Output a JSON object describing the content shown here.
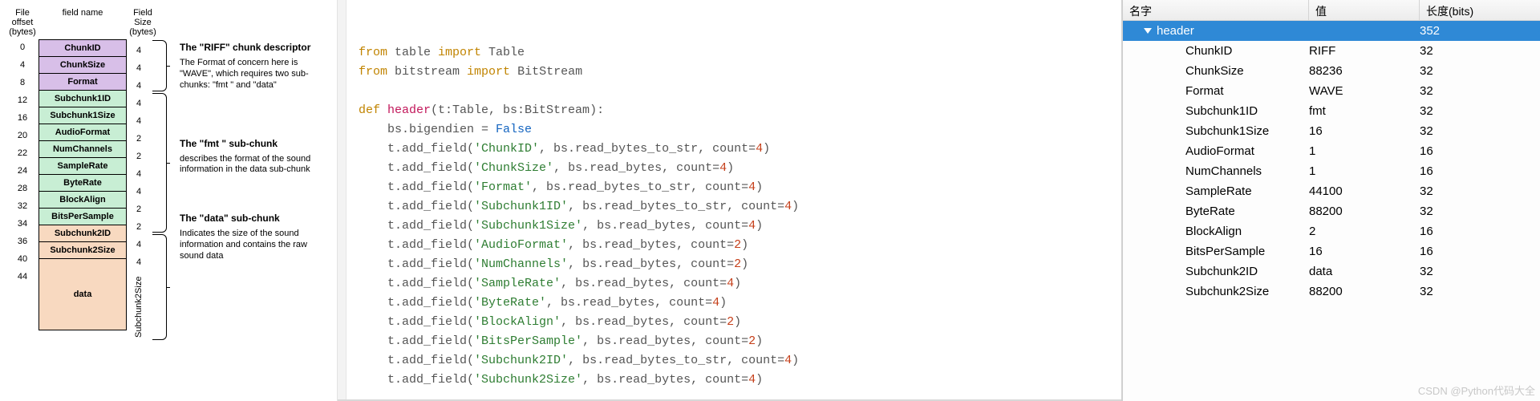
{
  "diagram": {
    "headers": {
      "offset": "File offset\n(bytes)",
      "name": "field name",
      "size": "Field Size\n(bytes)"
    },
    "offsets": [
      "0",
      "4",
      "8",
      "12",
      "16",
      "20",
      "22",
      "24",
      "28",
      "32",
      "34",
      "36",
      "40",
      "44"
    ],
    "fields": [
      {
        "name": "ChunkID",
        "size": "4",
        "cls": "c-purple"
      },
      {
        "name": "ChunkSize",
        "size": "4",
        "cls": "c-purple"
      },
      {
        "name": "Format",
        "size": "4",
        "cls": "c-purple"
      },
      {
        "name": "Subchunk1ID",
        "size": "4",
        "cls": "c-green"
      },
      {
        "name": "Subchunk1Size",
        "size": "4",
        "cls": "c-green"
      },
      {
        "name": "AudioFormat",
        "size": "2",
        "cls": "c-green"
      },
      {
        "name": "NumChannels",
        "size": "2",
        "cls": "c-green"
      },
      {
        "name": "SampleRate",
        "size": "4",
        "cls": "c-green"
      },
      {
        "name": "ByteRate",
        "size": "4",
        "cls": "c-green"
      },
      {
        "name": "BlockAlign",
        "size": "2",
        "cls": "c-green"
      },
      {
        "name": "BitsPerSample",
        "size": "2",
        "cls": "c-green"
      },
      {
        "name": "Subchunk2ID",
        "size": "4",
        "cls": "c-peach"
      },
      {
        "name": "Subchunk2Size",
        "size": "4",
        "cls": "c-peach"
      },
      {
        "name": "data",
        "size": "Subchunk2Size",
        "cls": "c-peach",
        "tall": true
      }
    ],
    "desc": [
      {
        "title": "The \"RIFF\" chunk descriptor",
        "text": "The Format of concern here is \"WAVE\", which requires two sub-chunks: \"fmt \" and \"data\""
      },
      {
        "title": "The \"fmt \" sub-chunk",
        "text": "describes the format of the sound information in the data sub-chunk"
      },
      {
        "title": "The \"data\" sub-chunk",
        "text": "Indicates the size of the sound information and contains the raw sound data"
      }
    ]
  },
  "code": {
    "lines": [
      {
        "t": "import",
        "p": [
          [
            "kw",
            "from"
          ],
          [
            "id",
            " table "
          ],
          [
            "kw",
            "import"
          ],
          [
            "id",
            " Table"
          ]
        ]
      },
      {
        "t": "import",
        "p": [
          [
            "kw",
            "from"
          ],
          [
            "id",
            " bitstream "
          ],
          [
            "kw",
            "import"
          ],
          [
            "id",
            " BitStream"
          ]
        ]
      },
      {
        "t": "blank",
        "p": []
      },
      {
        "t": "def",
        "p": [
          [
            "kw",
            "def "
          ],
          [
            "fn",
            "header"
          ],
          [
            "id",
            "(t:Table, bs:BitStream):"
          ]
        ]
      },
      {
        "t": "body",
        "p": [
          [
            "id",
            "    bs.bigendien = "
          ],
          [
            "const",
            "False"
          ]
        ]
      },
      {
        "t": "body",
        "p": [
          [
            "id",
            "    t.add_field("
          ],
          [
            "str",
            "'ChunkID'"
          ],
          [
            "id",
            ", bs.read_bytes_to_str, count="
          ],
          [
            "num",
            "4"
          ],
          [
            "id",
            ")"
          ]
        ]
      },
      {
        "t": "body",
        "p": [
          [
            "id",
            "    t.add_field("
          ],
          [
            "str",
            "'ChunkSize'"
          ],
          [
            "id",
            ", bs.read_bytes, count="
          ],
          [
            "num",
            "4"
          ],
          [
            "id",
            ")"
          ]
        ]
      },
      {
        "t": "body",
        "p": [
          [
            "id",
            "    t.add_field("
          ],
          [
            "str",
            "'Format'"
          ],
          [
            "id",
            ", bs.read_bytes_to_str, count="
          ],
          [
            "num",
            "4"
          ],
          [
            "id",
            ")"
          ]
        ]
      },
      {
        "t": "body",
        "p": [
          [
            "id",
            "    t.add_field("
          ],
          [
            "str",
            "'Subchunk1ID'"
          ],
          [
            "id",
            ", bs.read_bytes_to_str, count="
          ],
          [
            "num",
            "4"
          ],
          [
            "id",
            ")"
          ]
        ]
      },
      {
        "t": "body",
        "p": [
          [
            "id",
            "    t.add_field("
          ],
          [
            "str",
            "'Subchunk1Size'"
          ],
          [
            "id",
            ", bs.read_bytes, count="
          ],
          [
            "num",
            "4"
          ],
          [
            "id",
            ")"
          ]
        ]
      },
      {
        "t": "body",
        "p": [
          [
            "id",
            "    t.add_field("
          ],
          [
            "str",
            "'AudioFormat'"
          ],
          [
            "id",
            ", bs.read_bytes, count="
          ],
          [
            "num",
            "2"
          ],
          [
            "id",
            ")"
          ]
        ]
      },
      {
        "t": "body",
        "p": [
          [
            "id",
            "    t.add_field("
          ],
          [
            "str",
            "'NumChannels'"
          ],
          [
            "id",
            ", bs.read_bytes, count="
          ],
          [
            "num",
            "2"
          ],
          [
            "id",
            ")"
          ]
        ]
      },
      {
        "t": "body",
        "p": [
          [
            "id",
            "    t.add_field("
          ],
          [
            "str",
            "'SampleRate'"
          ],
          [
            "id",
            ", bs.read_bytes, count="
          ],
          [
            "num",
            "4"
          ],
          [
            "id",
            ")"
          ]
        ]
      },
      {
        "t": "body",
        "p": [
          [
            "id",
            "    t.add_field("
          ],
          [
            "str",
            "'ByteRate'"
          ],
          [
            "id",
            ", bs.read_bytes, count="
          ],
          [
            "num",
            "4"
          ],
          [
            "id",
            ")"
          ]
        ]
      },
      {
        "t": "body",
        "p": [
          [
            "id",
            "    t.add_field("
          ],
          [
            "str",
            "'BlockAlign'"
          ],
          [
            "id",
            ", bs.read_bytes, count="
          ],
          [
            "num",
            "2"
          ],
          [
            "id",
            ")"
          ]
        ]
      },
      {
        "t": "body",
        "p": [
          [
            "id",
            "    t.add_field("
          ],
          [
            "str",
            "'BitsPerSample'"
          ],
          [
            "id",
            ", bs.read_bytes, count="
          ],
          [
            "num",
            "2"
          ],
          [
            "id",
            ")"
          ]
        ]
      },
      {
        "t": "body",
        "p": [
          [
            "id",
            "    t.add_field("
          ],
          [
            "str",
            "'Subchunk2ID'"
          ],
          [
            "id",
            ", bs.read_bytes_to_str, count="
          ],
          [
            "num",
            "4"
          ],
          [
            "id",
            ")"
          ]
        ]
      },
      {
        "t": "body",
        "p": [
          [
            "id",
            "    t.add_field("
          ],
          [
            "str",
            "'Subchunk2Size'"
          ],
          [
            "id",
            ", bs.read_bytes, count="
          ],
          [
            "num",
            "4"
          ],
          [
            "id",
            ")"
          ]
        ]
      }
    ]
  },
  "inspector": {
    "headers": {
      "name": "名字",
      "value": "值",
      "len": "长度(bits)"
    },
    "root": {
      "name": "header",
      "value": "",
      "len": "352"
    },
    "rows": [
      {
        "name": "ChunkID",
        "value": "RIFF",
        "len": "32"
      },
      {
        "name": "ChunkSize",
        "value": "88236",
        "len": "32"
      },
      {
        "name": "Format",
        "value": "WAVE",
        "len": "32"
      },
      {
        "name": "Subchunk1ID",
        "value": "fmt",
        "len": "32"
      },
      {
        "name": "Subchunk1Size",
        "value": "16",
        "len": "32"
      },
      {
        "name": "AudioFormat",
        "value": "1",
        "len": "16"
      },
      {
        "name": "NumChannels",
        "value": "1",
        "len": "16"
      },
      {
        "name": "SampleRate",
        "value": "44100",
        "len": "32"
      },
      {
        "name": "ByteRate",
        "value": "88200",
        "len": "32"
      },
      {
        "name": "BlockAlign",
        "value": "2",
        "len": "16"
      },
      {
        "name": "BitsPerSample",
        "value": "16",
        "len": "16"
      },
      {
        "name": "Subchunk2ID",
        "value": "data",
        "len": "32"
      },
      {
        "name": "Subchunk2Size",
        "value": "88200",
        "len": "32"
      }
    ],
    "watermark": "CSDN @Python代码大全"
  }
}
